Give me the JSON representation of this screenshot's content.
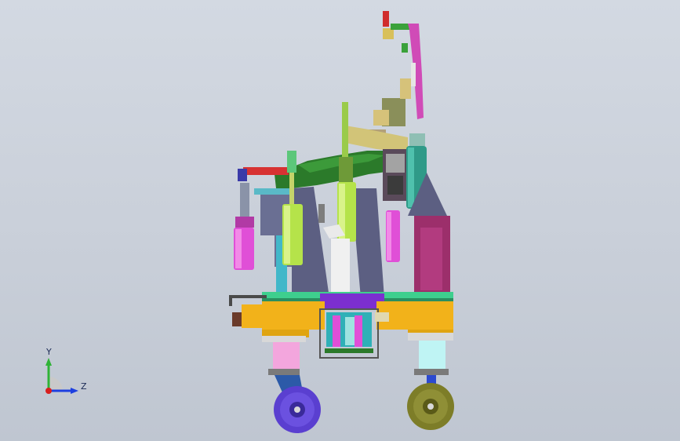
{
  "viewport": {
    "background_top": "#d3d9e2",
    "background_bottom": "#bfc6d1"
  },
  "triad": {
    "y_label": "Y",
    "z_label": "Z",
    "y_axis_color": "#2fb336",
    "z_axis_color": "#1d3fe0",
    "origin_color": "#d81e1e"
  },
  "model": {
    "description_icon": "cad-assembly-icon",
    "colors": {
      "base_plate": "#3ecf8e",
      "yellow_block": "#f2b21a",
      "purple_cylinder": "#e14fd7",
      "lime_cylinder": "#b5e34a",
      "teal_cylinder": "#2f9a88",
      "dark_green_panel": "#2b7a2a",
      "slate_frame": "#6a6f93",
      "maroon_block": "#9c2f6b",
      "red_arm": "#e23a3a",
      "wheel_left": "#5a3fd0",
      "wheel_right": "#7d7d28",
      "leg_pink": "#f3a6dd",
      "leg_cyan": "#bff4f4"
    }
  }
}
